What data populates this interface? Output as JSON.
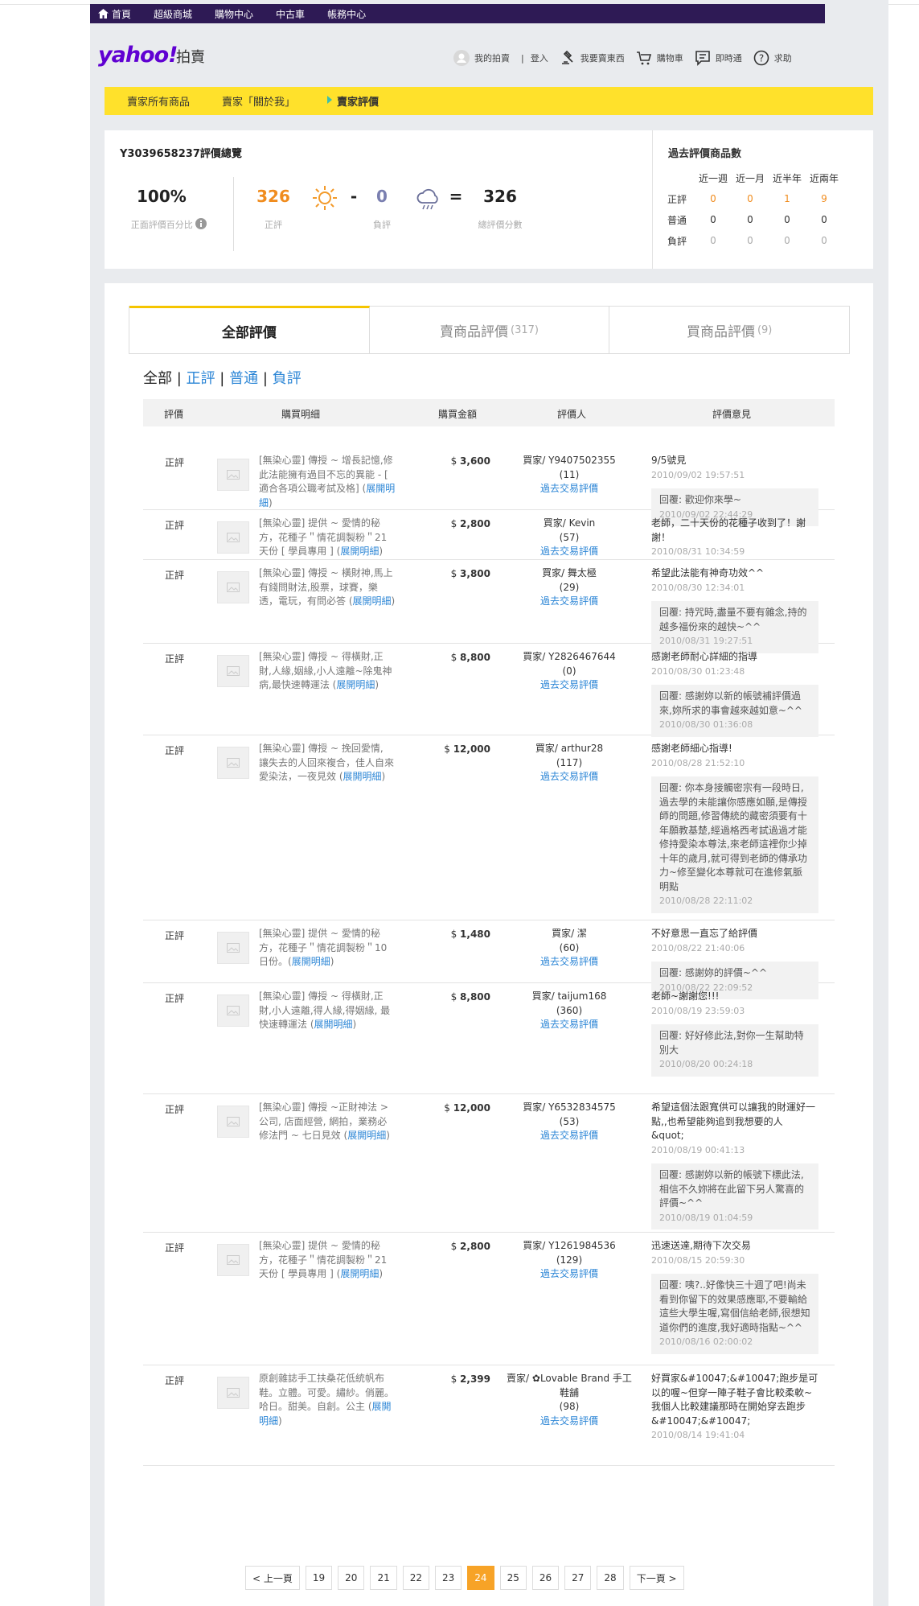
{
  "topbar": {
    "items": [
      "首頁",
      "超級商城",
      "購物中心",
      "中古車",
      "帳務中心"
    ]
  },
  "header": {
    "logo": "yahoo!",
    "logo_sub": "拍賣",
    "links": [
      "我的拍賣",
      "|",
      "登入",
      "我要賣東西",
      "購物車",
      "即時通",
      "求助"
    ]
  },
  "subnav": {
    "items": [
      "賣家所有商品",
      "賣家「關於我」"
    ],
    "current": "賣家評價"
  },
  "summary": {
    "title": "Y3039658237評價總覽",
    "pct": "100%",
    "pct_label": "正面評價百分比",
    "pos": "326",
    "pos_label": "正評",
    "minus": "-",
    "neg": "0",
    "neg_label": "負評",
    "eq": "=",
    "total": "326",
    "total_label": "總評價分數"
  },
  "past": {
    "title": "過去評價商品數",
    "cols": [
      "近一週",
      "近一月",
      "近半年",
      "近兩年"
    ],
    "rows": [
      {
        "label": "正評",
        "values": [
          "0",
          "0",
          "1",
          "9"
        ]
      },
      {
        "label": "普通",
        "values": [
          "0",
          "0",
          "0",
          "0"
        ]
      },
      {
        "label": "負評",
        "values": [
          "0",
          "0",
          "0",
          "0"
        ]
      }
    ]
  },
  "tabs": [
    {
      "label": "全部評價",
      "count": ""
    },
    {
      "label": "賣商品評價",
      "count": "(317)"
    },
    {
      "label": "買商品評價",
      "count": "(9)"
    }
  ],
  "filters": {
    "all": "全部",
    "sep": "|",
    "pos": "正評",
    "neu": "普通",
    "neg": "負評"
  },
  "table": {
    "headers": [
      "評價",
      "購買明細",
      "購買金額",
      "評價人",
      "評價意見"
    ]
  },
  "rows": [
    {
      "rating": "正評",
      "item": "[無染心靈] 傳授 ~ 增長記憶,修此法能擁有過目不忘的異能 - [ 適合各項公職考試及格] (",
      "link": "展開明細",
      "item_end": ")",
      "amount": "3,600",
      "buyer": "買家/ Y9407502355",
      "count": "(11)",
      "past": "過去交易評價",
      "comment": "9/5號見",
      "date": "2010/09/02 19:57:51",
      "reply": "回覆: 歡迎你來學~",
      "reply_date": "2010/09/02 22:44:29"
    },
    {
      "rating": "正評",
      "item": "[無染心靈] 提供 ~ 愛情的秘方，花種子＂情花調製粉＂21天份 [ 學員專用 ] (",
      "link": "展開明細",
      "item_end": ")",
      "amount": "2,800",
      "buyer": "買家/ Kevin",
      "count": "(57)",
      "past": "過去交易評價",
      "comment": "老師，二十天份的花種子收到了！謝謝！",
      "date": "2010/08/31 10:34:59",
      "reply": "",
      "reply_date": ""
    },
    {
      "rating": "正評",
      "item": "[無染心靈] 傳授 ~ 橫財神,馬上有錢問財法,股票，球賽，樂透，電玩，有問必答 (",
      "link": "展開明細",
      "item_end": ")",
      "amount": "3,800",
      "buyer": "買家/ 舞太極",
      "count": "(29)",
      "past": "過去交易評價",
      "comment": "希望此法能有神奇功效^^",
      "date": "2010/08/30 12:34:01",
      "reply": "回覆: 持咒時,盡量不要有雜念,持的越多福份來的越快~^^",
      "reply_date": "2010/08/31 19:27:51"
    },
    {
      "rating": "正評",
      "item": "[無染心靈] 傳授 ~ 得橫財,正財,人緣,姻緣,小人遠離~除鬼神病,最快速轉運法 (",
      "link": "展開明細",
      "item_end": ")",
      "amount": "8,800",
      "buyer": "買家/ Y2826467644",
      "count": "(0)",
      "past": "過去交易評價",
      "comment": "感謝老師耐心詳細的指導",
      "date": "2010/08/30 01:23:48",
      "reply": "回覆: 感謝妳以新的帳號補評價過來,妳所求的事會越來越如意~^^",
      "reply_date": "2010/08/30 01:36:08"
    },
    {
      "rating": "正評",
      "item": "[無染心靈] 傳授 ~ 挽回愛情, 讓失去的人回來複合，佳人自來愛染法，一夜見效 (",
      "link": "展開明細",
      "item_end": ")",
      "amount": "12,000",
      "buyer": "買家/ arthur28",
      "count": "(117)",
      "past": "過去交易評價",
      "comment": "感謝老師細心指導!",
      "date": "2010/08/28 21:52:10",
      "reply": "回覆: 你本身接觸密宗有一段時日,過去學的未能讓你感應如願,是傳授師的問題,修習傳統的藏密須要有十年願教基楚,經過格西考試過過才能修持愛染本尊法,來老師這裡你少掉十年的歲月,就可得到老師的傳承功力~修至變化本尊就可在進修氣脈明點",
      "reply_date": "2010/08/28 22:11:02"
    },
    {
      "rating": "正評",
      "item": "[無染心靈] 提供 ~ 愛情的秘方，花種子＂情花調製粉＂10日份。(",
      "link": "展開明細",
      "item_end": ")",
      "amount": "1,480",
      "buyer": "買家/ 潔",
      "count": "(60)",
      "past": "過去交易評價",
      "comment": "不好意思一直忘了給評價",
      "date": "2010/08/22 21:40:06",
      "reply": "回覆: 感謝妳的評價~^^",
      "reply_date": "2010/08/22 22:09:52"
    },
    {
      "rating": "正評",
      "item": "[無染心靈] 傳授 ~ 得橫財,正財,小人遠離,得人緣,得姻緣, 最快速轉運法 (",
      "link": "展開明細",
      "item_end": ")",
      "amount": "8,800",
      "buyer": "買家/ taijum168",
      "count": "(360)",
      "past": "過去交易評價",
      "comment": "老師~謝謝您!!!",
      "date": "2010/08/19 23:59:03",
      "reply": "回覆: 好好修此法,對你一生幫助特別大",
      "reply_date": "2010/08/20 00:24:18"
    },
    {
      "rating": "正評",
      "item": "[無染心靈] 傳授 ~正財神法 >公司, 店面經營, 網拍，業務必修法門 ~ 七日見效 (",
      "link": "展開明細",
      "item_end": ")",
      "amount": "12,000",
      "buyer": "買家/ Y6532834575",
      "count": "(53)",
      "past": "過去交易評價",
      "comment": "希望這個法跟寬供可以讓我的財運好一點,,也希望能夠追到我想要的人 &quot;",
      "date": "2010/08/19 00:41:13",
      "reply": "回覆: 感謝妳以新的帳號下標此法,相信不久妳將在此留下另人驚喜的評價~^^",
      "reply_date": "2010/08/19 01:04:59"
    },
    {
      "rating": "正評",
      "item": "[無染心靈] 提供 ~ 愛情的秘方，花種子＂情花調製粉＂21天份 [ 學員專用 ] (",
      "link": "展開明細",
      "item_end": ")",
      "amount": "2,800",
      "buyer": "買家/ Y1261984536",
      "count": "(129)",
      "past": "過去交易評價",
      "comment": "迅速送達,期待下次交易",
      "date": "2010/08/15 20:59:30",
      "reply": "回覆: 咦?..好像快三十週了吧!尚未看到你留下的效果感應耶,不要輸給這些大學生喔,寫個信給老師,很想知道你們的進度,我好適時指點~^^",
      "reply_date": "2010/08/16 02:00:02"
    },
    {
      "rating": "正評",
      "item": "原創雜誌手工扶桑花低統帆布鞋。立體。可愛。繡紗。俏麗。哈日。甜美。自創。公主 (",
      "link": "展開明細",
      "item_end": ")",
      "amount": "2,399",
      "buyer": "賣家/ ✿Lovable Brand 手工鞋舖",
      "count": "(98)",
      "past": "過去交易評價",
      "comment": "好買家&#10047;&#10047;跑步是可以的喔~但穿一陣子鞋子會比較柔軟~我個人比較建議那時在開始穿去跑步&#10047;&#10047;",
      "date": "2010/08/14 19:41:04",
      "reply": "",
      "reply_date": ""
    }
  ],
  "pager": {
    "prev": "< 上一頁",
    "pages": [
      "19",
      "20",
      "21",
      "22",
      "23",
      "24",
      "25",
      "26",
      "27",
      "28"
    ],
    "current": "24",
    "next": "下一頁 >"
  },
  "colors": {
    "topbar": "#2e1a55",
    "yellow": "#ffe12b",
    "pos": "#f08c1e",
    "link": "#2c86d6",
    "current_page": "#f7a327"
  }
}
